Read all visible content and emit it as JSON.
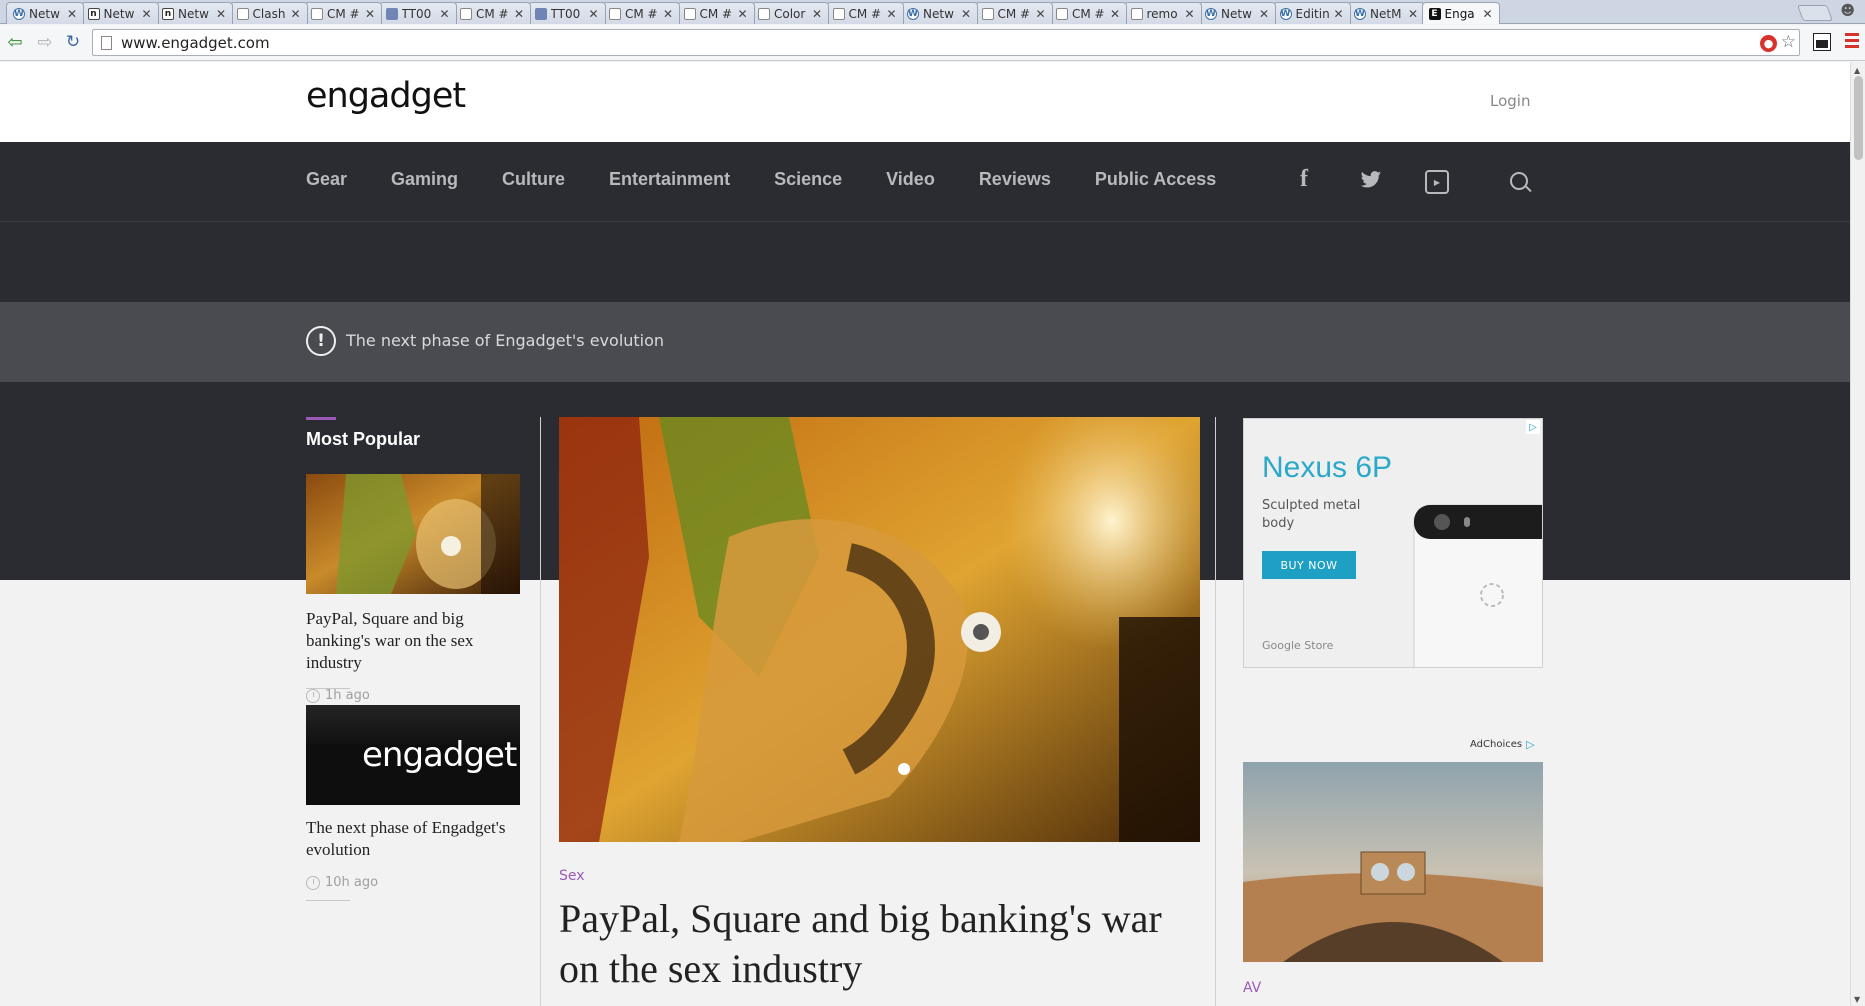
{
  "browser": {
    "tabs": [
      {
        "title": "Netw",
        "favicon": "wp-icon"
      },
      {
        "title": "Netw",
        "favicon": "n-icon"
      },
      {
        "title": "Netw",
        "favicon": "n-icon"
      },
      {
        "title": "Clash",
        "favicon": "doc-icon"
      },
      {
        "title": "CM #",
        "favicon": "doc-icon"
      },
      {
        "title": "TT00",
        "favicon": "tool-icon"
      },
      {
        "title": "CM #",
        "favicon": "doc-icon"
      },
      {
        "title": "TT00",
        "favicon": "tool-icon"
      },
      {
        "title": "CM #",
        "favicon": "doc-icon"
      },
      {
        "title": "CM #",
        "favicon": "doc-icon"
      },
      {
        "title": "Color",
        "favicon": "doc-icon"
      },
      {
        "title": "CM #",
        "favicon": "doc-icon"
      },
      {
        "title": "Netw",
        "favicon": "wp-icon"
      },
      {
        "title": "CM #",
        "favicon": "doc-icon"
      },
      {
        "title": "CM #",
        "favicon": "doc-icon"
      },
      {
        "title": "remo",
        "favicon": "doc-icon"
      },
      {
        "title": "Netw",
        "favicon": "wp-icon"
      },
      {
        "title": "Editin",
        "favicon": "wp-icon"
      },
      {
        "title": "NetM",
        "favicon": "wp-icon"
      },
      {
        "title": "Enga",
        "favicon": "engadget-icon",
        "active": true
      }
    ],
    "url": "www.engadget.com"
  },
  "site": {
    "logo": "engadget",
    "login": "Login",
    "nav": [
      "Gear",
      "Gaming",
      "Culture",
      "Entertainment",
      "Science",
      "Video",
      "Reviews",
      "Public Access"
    ],
    "social_icons": [
      "facebook-icon",
      "twitter-icon",
      "youtube-icon"
    ],
    "notice": {
      "icon": "!",
      "text": "The next phase of Engadget's evolution"
    }
  },
  "most_popular": {
    "title": "Most Popular",
    "items": [
      {
        "headline": "PayPal, Square and big banking's war on the sex industry",
        "time": "1h ago"
      },
      {
        "headline": "The next phase of Engadget's evolution",
        "time": "10h ago",
        "thumb_text": "engadget"
      }
    ]
  },
  "main_story": {
    "category": "Sex",
    "headline": "PayPal, Square and big banking's war on the sex industry"
  },
  "ad": {
    "title": "Nexus 6P",
    "subtitle": "Sculpted metal body",
    "button": "BUY NOW",
    "store": "Google Store",
    "adchoices": "AdChoices"
  },
  "side_story": {
    "category": "AV"
  },
  "colors": {
    "nav_bg": "#2b2c31",
    "notice_bg": "#4a4b50",
    "accent_purple": "#9b5ab8",
    "ad_accent": "#2aa9c9"
  }
}
